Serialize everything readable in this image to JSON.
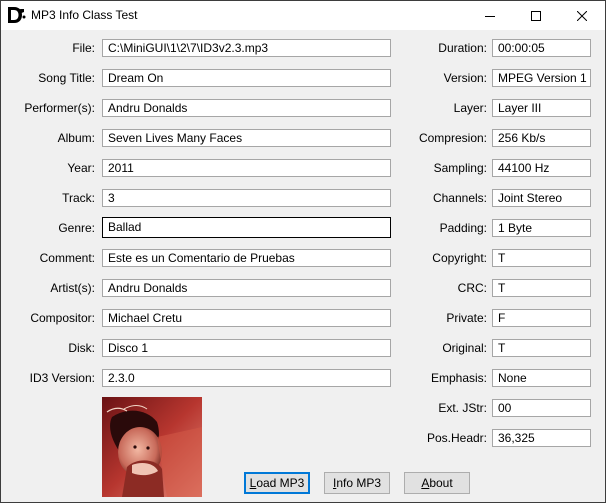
{
  "window": {
    "title": "MP3 Info Class Test"
  },
  "fields_left": [
    {
      "label": "File:",
      "value": "C:\\MiniGUI\\1\\2\\7\\ID3v2.3.mp3"
    },
    {
      "label": "Song Title:",
      "value": "Dream On"
    },
    {
      "label": "Performer(s):",
      "value": "Andru Donalds"
    },
    {
      "label": "Album:",
      "value": "Seven Lives Many Faces"
    },
    {
      "label": "Year:",
      "value": "2011"
    },
    {
      "label": "Track:",
      "value": "3"
    },
    {
      "label": "Genre:",
      "value": "Ballad"
    },
    {
      "label": "Comment:",
      "value": "Este es un Comentario de Pruebas"
    },
    {
      "label": "Artist(s):",
      "value": "Andru Donalds"
    },
    {
      "label": "Compositor:",
      "value": "Michael Cretu"
    },
    {
      "label": "Disk:",
      "value": "Disco 1"
    },
    {
      "label": "ID3 Version:",
      "value": "2.3.0"
    }
  ],
  "fields_right": [
    {
      "label": "Duration:",
      "value": "00:00:05"
    },
    {
      "label": "Version:",
      "value": "MPEG Version 1"
    },
    {
      "label": "Layer:",
      "value": "Layer III"
    },
    {
      "label": "Compresion:",
      "value": "256 Kb/s"
    },
    {
      "label": "Sampling:",
      "value": "44100 Hz"
    },
    {
      "label": "Channels:",
      "value": "Joint Stereo"
    },
    {
      "label": "Padding:",
      "value": "1 Byte"
    },
    {
      "label": "Copyright:",
      "value": "T"
    },
    {
      "label": "CRC:",
      "value": "T"
    },
    {
      "label": "Private:",
      "value": "F"
    },
    {
      "label": "Original:",
      "value": "T"
    },
    {
      "label": "Emphasis:",
      "value": "None"
    },
    {
      "label": "Ext. JStr:",
      "value": "00"
    },
    {
      "label": "Pos.Headr:",
      "value": "36,325"
    }
  ],
  "buttons": {
    "load": {
      "mnemonic": "L",
      "rest": "oad MP3"
    },
    "info": {
      "mnemonic": "I",
      "rest": "nfo MP3"
    },
    "about": {
      "mnemonic": "A",
      "rest": "bout"
    }
  },
  "icons": {
    "app": "app-icon",
    "minimize": "minimize-icon",
    "maximize": "maximize-icon",
    "close": "close-icon"
  },
  "colors": {
    "window_bg": "#f0f0f0",
    "field_border": "#a6a6a6",
    "focused_border": "#000000",
    "default_button_border": "#0078d7"
  }
}
